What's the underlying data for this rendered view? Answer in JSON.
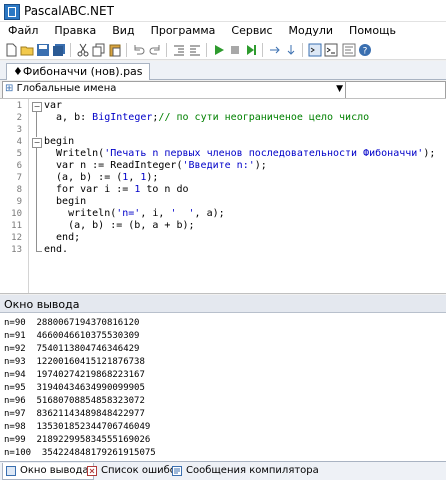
{
  "window": {
    "title": "PascalABC.NET"
  },
  "menu": [
    "Файл",
    "Правка",
    "Вид",
    "Программа",
    "Сервис",
    "Модули",
    "Помощь"
  ],
  "tab": {
    "label": "Фибоначчи (нов).pas"
  },
  "names_combo": {
    "value": "Глобальные имена"
  },
  "editor": {
    "line_numbers": [
      "1",
      "2",
      "3",
      "4",
      "5",
      "6",
      "7",
      "8",
      "9",
      "10",
      "11",
      "12",
      "13"
    ],
    "lines": [
      "var",
      "  a, b: BigInteger;// по сути неограниченое цело число",
      "",
      "begin",
      "  Writeln('Печать n первых членов последовательности Фибоначчи');",
      "  var n := ReadInteger('Введите n:');",
      "  (a, b) := (1, 1);",
      "  for var i := 1 to n do",
      "  begin",
      "    writeln('n=', i, '  ', a);",
      "    (a, b) := (b, a + b);",
      "  end;",
      "end."
    ]
  },
  "output": {
    "title": "Окно вывода",
    "lines": [
      "n=90  2880067194370816120",
      "n=91  4660046610375530309",
      "n=92  7540113804746346429",
      "n=93  12200160415121876738",
      "n=94  19740274219868223167",
      "n=95  31940434634990099905",
      "n=96  51680708854858323072",
      "n=97  83621143489848422977",
      "n=98  135301852344706746049",
      "n=99  218922995834555169026",
      "n=100  354224848179261915075"
    ]
  },
  "bottom_tabs": [
    "Окно вывода",
    "Список ошибок",
    "Сообщения компилятора"
  ],
  "colors": {
    "keyword": "#000000",
    "type": "#0000c8",
    "comment": "#008000",
    "string": "#0000c8"
  }
}
